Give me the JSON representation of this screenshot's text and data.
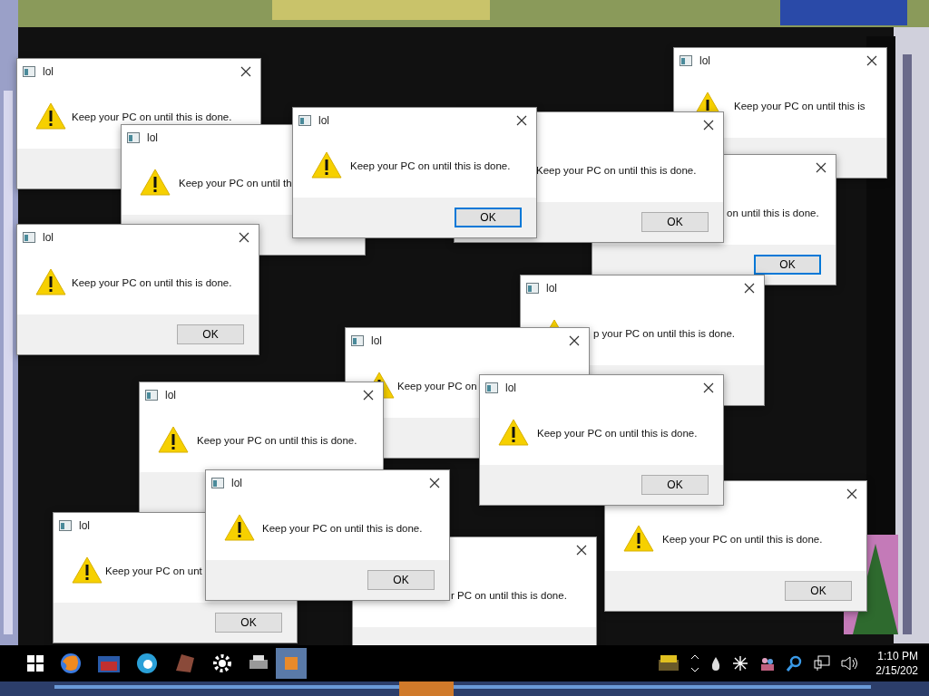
{
  "dialogs": [
    {
      "title": "lol",
      "message": "Keep your PC on until this is"
    },
    {
      "title": "lol",
      "message": "Keep your PC on until this is done."
    },
    {
      "title": "lol",
      "message": "Keep your PC on until this is done.",
      "button": "OK",
      "focused": true
    },
    {
      "message": "Keep your PC on until this is done.",
      "button": "OK",
      "focused": false
    },
    {
      "title": "lol",
      "message": "Keep your PC on until th"
    },
    {
      "message": "on until this is done.",
      "button": "OK",
      "focused": true
    },
    {
      "title": "lol",
      "message": "Keep your PC on until this is done.",
      "button": "OK",
      "focused": false
    },
    {
      "title": "lol",
      "message": "p your PC on until this is done."
    },
    {
      "title": "lol",
      "message": "Keep your PC on"
    },
    {
      "title": "lol",
      "message": "Keep your PC on until this is done.",
      "button": "OK",
      "focused": false
    },
    {
      "title": "lol",
      "message": "Keep your PC on until this is done."
    },
    {
      "title": "lol",
      "message": "Keep your PC on until this is done.",
      "button": "OK",
      "focused": false
    },
    {
      "message": "Keep your PC on until this is done.",
      "button": "OK",
      "focused": false
    },
    {
      "title": "lol",
      "message": "Keep your PC on unt",
      "button": "OK",
      "focused": false
    },
    {
      "message": "r PC on until this is done."
    }
  ],
  "taskbar": {
    "clock_time": "1:10 PM",
    "clock_date": "2/15/202"
  }
}
